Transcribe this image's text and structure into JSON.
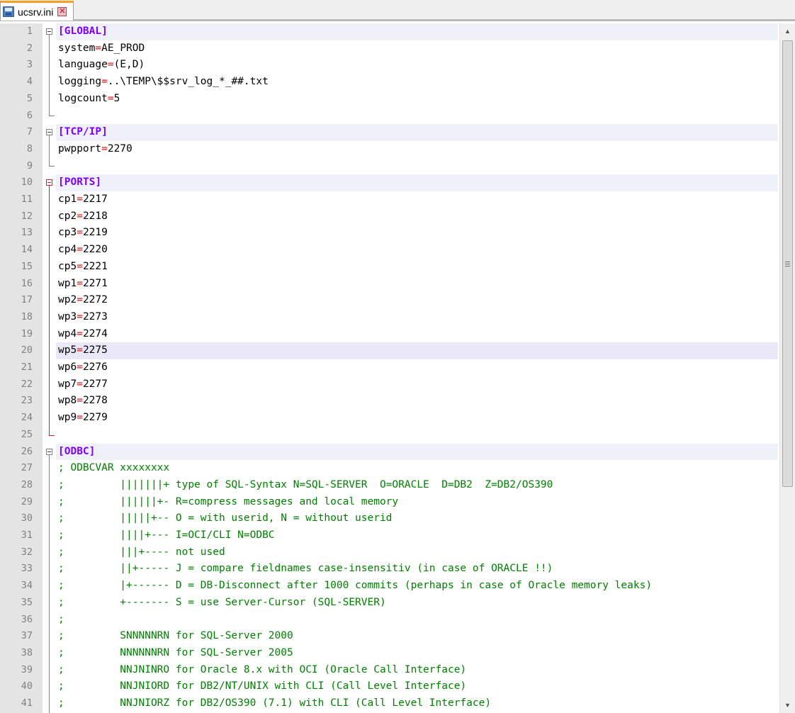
{
  "tab": {
    "label": "ucsrv.ini",
    "icon": "save-icon",
    "close_icon": "close-icon"
  },
  "colors": {
    "key": "#000000",
    "operator": "#e01010",
    "section": "#8000ff",
    "comment": "#008000",
    "line_number": "#808080"
  },
  "lines": [
    {
      "n": "1",
      "section": "[GLOBAL]"
    },
    {
      "n": "2",
      "key": "system",
      "op": "=",
      "value": "AE_PROD"
    },
    {
      "n": "3",
      "key": "language",
      "op": "=",
      "value": "(E,D)"
    },
    {
      "n": "4",
      "key": "logging",
      "op": "=",
      "value": "..\\TEMP\\$$srv_log_*_##.txt"
    },
    {
      "n": "5",
      "key": "logcount",
      "op": "=",
      "value": "5"
    },
    {
      "n": "6"
    },
    {
      "n": "7",
      "section": "[TCP/IP]"
    },
    {
      "n": "8",
      "key": "pwpport",
      "op": "=",
      "value": "2270"
    },
    {
      "n": "9"
    },
    {
      "n": "10",
      "section": "[PORTS]"
    },
    {
      "n": "11",
      "key": "cp1",
      "op": "=",
      "value": "2217"
    },
    {
      "n": "12",
      "key": "cp2",
      "op": "=",
      "value": "2218"
    },
    {
      "n": "13",
      "key": "cp3",
      "op": "=",
      "value": "2219"
    },
    {
      "n": "14",
      "key": "cp4",
      "op": "=",
      "value": "2220"
    },
    {
      "n": "15",
      "key": "cp5",
      "op": "=",
      "value": "2221"
    },
    {
      "n": "16",
      "key": "wp1",
      "op": "=",
      "value": "2271"
    },
    {
      "n": "17",
      "key": "wp2",
      "op": "=",
      "value": "2272"
    },
    {
      "n": "18",
      "key": "wp3",
      "op": "=",
      "value": "2273"
    },
    {
      "n": "19",
      "key": "wp4",
      "op": "=",
      "value": "2274"
    },
    {
      "n": "20",
      "key": "wp5",
      "op": "=",
      "value": "2275"
    },
    {
      "n": "21",
      "key": "wp6",
      "op": "=",
      "value": "2276"
    },
    {
      "n": "22",
      "key": "wp7",
      "op": "=",
      "value": "2277"
    },
    {
      "n": "23",
      "key": "wp8",
      "op": "=",
      "value": "2278"
    },
    {
      "n": "24",
      "key": "wp9",
      "op": "=",
      "value": "2279"
    },
    {
      "n": "25"
    },
    {
      "n": "26",
      "section": "[ODBC]"
    },
    {
      "n": "27",
      "comment": "; ODBCVAR xxxxxxxx"
    },
    {
      "n": "28",
      "comment": ";         |||||||+ type of SQL-Syntax N=SQL-SERVER  O=ORACLE  D=DB2  Z=DB2/OS390"
    },
    {
      "n": "29",
      "comment": ";         ||||||+- R=compress messages and local memory"
    },
    {
      "n": "30",
      "comment": ";         |||||+-- O = with userid, N = without userid"
    },
    {
      "n": "31",
      "comment": ";         ||||+--- I=OCI/CLI N=ODBC"
    },
    {
      "n": "32",
      "comment": ";         |||+---- not used"
    },
    {
      "n": "33",
      "comment": ";         ||+----- J = compare fieldnames case-insensitiv (in case of ORACLE !!)"
    },
    {
      "n": "34",
      "comment": ";         |+------ D = DB-Disconnect after 1000 commits (perhaps in case of Oracle memory leaks)"
    },
    {
      "n": "35",
      "comment": ";         +------- S = use Server-Cursor (SQL-SERVER)"
    },
    {
      "n": "36",
      "comment": ";"
    },
    {
      "n": "37",
      "comment": ";         SNNNNNRN for SQL-Server 2000"
    },
    {
      "n": "38",
      "comment": ";         NNNNNNRN for SQL-Server 2005"
    },
    {
      "n": "39",
      "comment": ";         NNJNINRO for Oracle 8.x with OCI (Oracle Call Interface)"
    },
    {
      "n": "40",
      "comment": ";         NNJNIORD for DB2/NT/UNIX with CLI (Call Level Interface)"
    },
    {
      "n": "41",
      "comment": ";         NNJNIORZ for DB2/OS390 (7.1) with CLI (Call Level Interface)"
    }
  ]
}
